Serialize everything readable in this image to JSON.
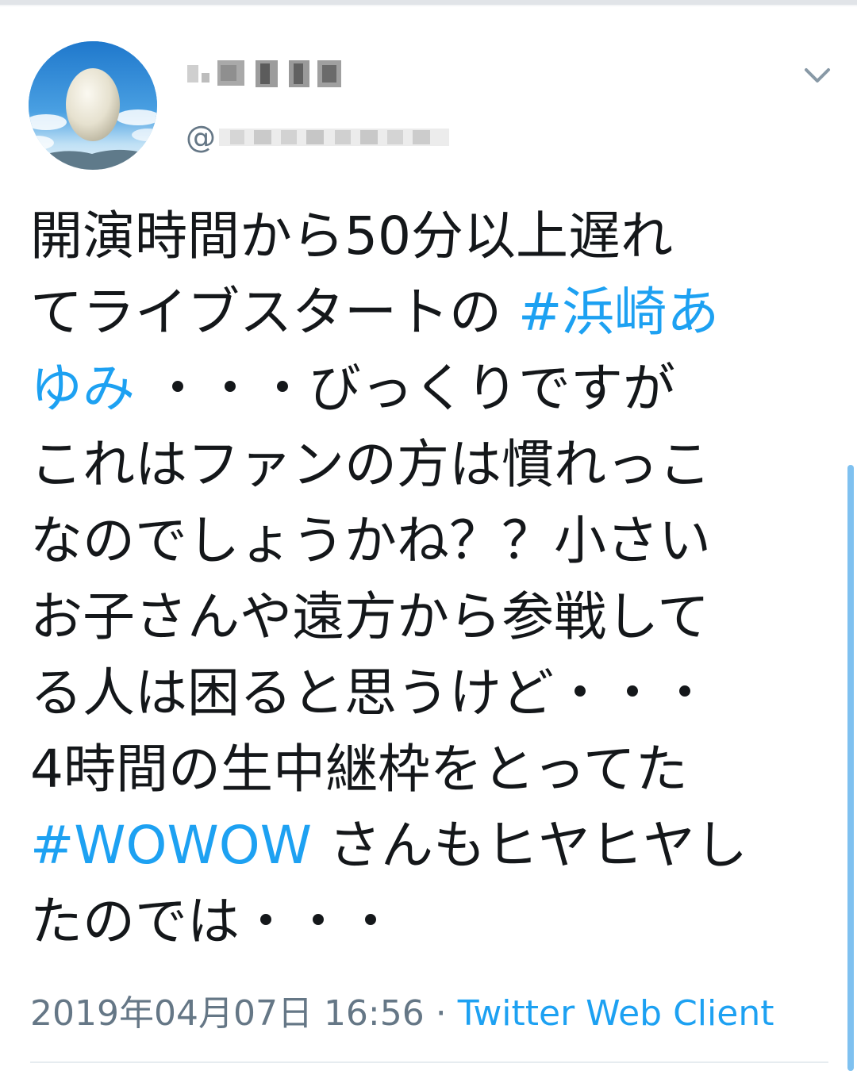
{
  "tweet": {
    "handle_prefix": "@",
    "text_lines": [
      [
        {
          "t": "開演時間から50分以上遅れ",
          "h": false
        }
      ],
      [
        {
          "t": "てライブスタートの ",
          "h": false
        },
        {
          "t": "#浜崎あ",
          "h": true
        }
      ],
      [
        {
          "t": "ゆみ",
          "h": true
        },
        {
          "t": " ・・・びっくりですが",
          "h": false
        }
      ],
      [
        {
          "t": "これはファンの方は慣れっこ",
          "h": false
        }
      ],
      [
        {
          "t": "なのでしょうかね？？小さい",
          "h": false
        }
      ],
      [
        {
          "t": "お子さんや遠方から参戦して",
          "h": false
        }
      ],
      [
        {
          "t": "る人は困ると思うけど・・・",
          "h": false
        }
      ],
      [
        {
          "t": "4時間の生中継枠をとってた",
          "h": false
        }
      ],
      [
        {
          "t": "#WOWOW",
          "h": true
        },
        {
          "t": " さんもヒヤヒヤし",
          "h": false
        }
      ],
      [
        {
          "t": "たのでは・・・",
          "h": false
        }
      ]
    ],
    "timestamp": "2019年04月07日 16:56",
    "separator": " · ",
    "client": "Twitter Web Client"
  },
  "colors": {
    "text": "#14171a",
    "hashtag": "#1da1f2",
    "meta": "#657786",
    "divider": "#e6ecf0"
  },
  "icons": {
    "avatar": "egg-on-sky-avatar",
    "caret": "chevron-down-icon"
  }
}
